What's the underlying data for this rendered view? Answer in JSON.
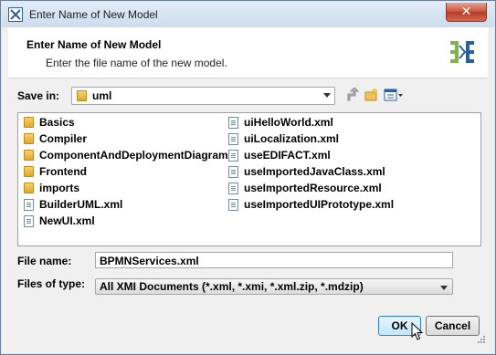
{
  "window": {
    "title": "Enter Name of New Model",
    "close_glyph": "✕"
  },
  "header": {
    "title": "Enter Name of New Model",
    "subtitle": "Enter the file name of the new model."
  },
  "save_in": {
    "label": "Save in:",
    "value": "uml",
    "toolbar_icons": [
      "up-folder-icon",
      "new-folder-icon",
      "view-menu-icon"
    ]
  },
  "files": {
    "column1": [
      {
        "name": "Basics",
        "type": "folder"
      },
      {
        "name": "Compiler",
        "type": "folder"
      },
      {
        "name": "ComponentAndDeploymentDiagram",
        "type": "folder"
      },
      {
        "name": "Frontend",
        "type": "folder"
      },
      {
        "name": "imports",
        "type": "folder"
      },
      {
        "name": "BuilderUML.xml",
        "type": "file"
      },
      {
        "name": "NewUI.xml",
        "type": "file"
      }
    ],
    "column2": [
      {
        "name": "uiHelloWorld.xml",
        "type": "file"
      },
      {
        "name": "uiLocalization.xml",
        "type": "file"
      },
      {
        "name": "useEDIFACT.xml",
        "type": "file"
      },
      {
        "name": "useImportedJavaClass.xml",
        "type": "file"
      },
      {
        "name": "useImportedResource.xml",
        "type": "file"
      },
      {
        "name": "useImportedUIPrototype.xml",
        "type": "file"
      }
    ]
  },
  "file_name": {
    "label": "File name:",
    "value": "BPMNServices.xml"
  },
  "file_type": {
    "label": "Files of type:",
    "value": "All XMI Documents (*.xml, *.xmi, *.xml.zip, *.mdzip)"
  },
  "buttons": {
    "ok": "OK",
    "cancel": "Cancel"
  },
  "colors": {
    "accent": "#3c7fb1",
    "folder": "#e0a72b",
    "logo_green": "#7ab648",
    "logo_blue": "#2a5f9e"
  }
}
